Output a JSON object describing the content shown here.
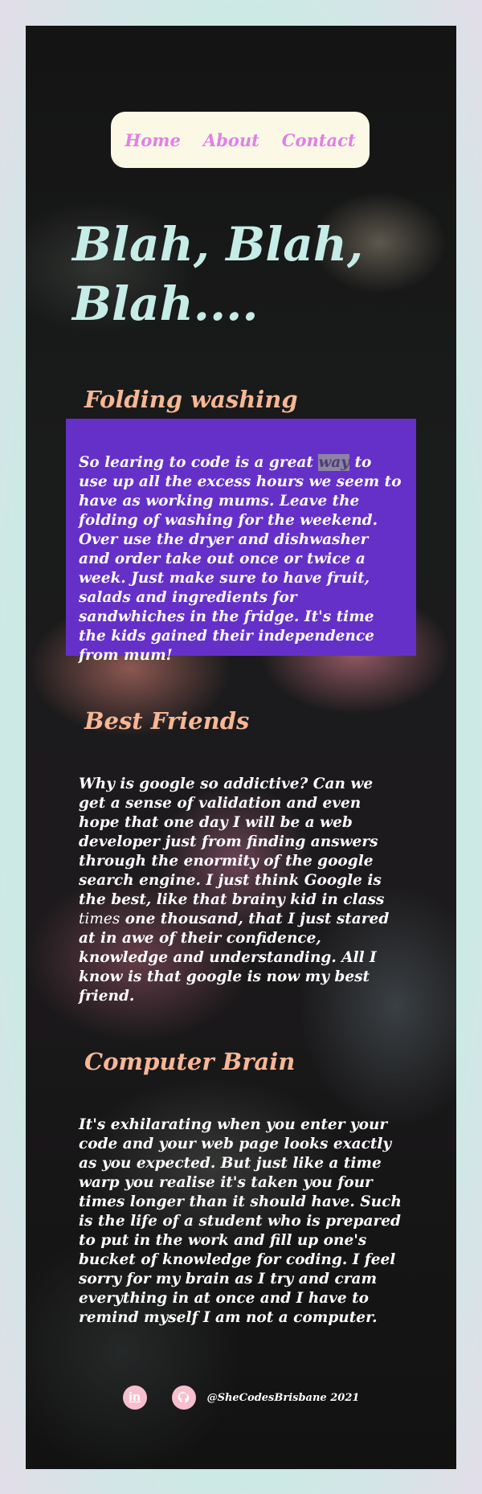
{
  "nav": {
    "home": "Home",
    "about": "About",
    "contact": "Contact"
  },
  "hero": {
    "title": "Blah, Blah,\nBlah...."
  },
  "sections": [
    {
      "heading": "Folding washing",
      "text_before": "So learing to code is a great ",
      "highlight": "way",
      "text_after": " to\nuse up all the excess hours we seem to\nhave as working mums. Leave the\nfolding of washing for the weekend.\nOver use the dryer and dishwasher\nand order take out once or twice a\nweek. Just make sure to have fruit,\nsalads and ingredients for\nsandwhiches in the fridge. It's time\nthe kids gained their independence\nfrom mum!"
    },
    {
      "heading": "Best Friends",
      "text_before": "Why is google so addictive? Can we\nget a sense of validation and even\nhope that one day I will be a web\ndeveloper just from finding answers\nthrough the enormity of the google\nsearch engine. I just think Google is\nthe best, like that brainy kid in class\n",
      "emphasis": "times",
      "text_after": " one thousand, that I just stared\nat in awe of their confidence,\nknowledge and understanding. All I\nknow is that google is now my best\nfriend."
    },
    {
      "heading": "Computer Brain",
      "text": "It's exhilarating when you enter your\ncode and your web page looks exactly\nas you expected. But just like a time\nwarp you realise it's taken you four\ntimes longer than it should have. Such\nis the life of a student who is prepared\nto put in the work and fill up one's\nbucket of knowledge for coding. I feel\nsorry for my brain as I try and cram\neverything in at once and I have to\nremind myself I am not a computer."
    }
  ],
  "footer": {
    "linkedin_icon": "linkedin-icon",
    "linkedin_glyph": "in",
    "github_icon": "github-icon",
    "credit": "@SheCodesBrisbane 2021"
  },
  "colors": {
    "nav_background": "#fbf9e6",
    "nav_link": "#e27fe6",
    "hero": "#c5ece6",
    "heading": "#f6b795",
    "purple_box": "#6530c8",
    "social_icon": "#f7bfcc"
  }
}
